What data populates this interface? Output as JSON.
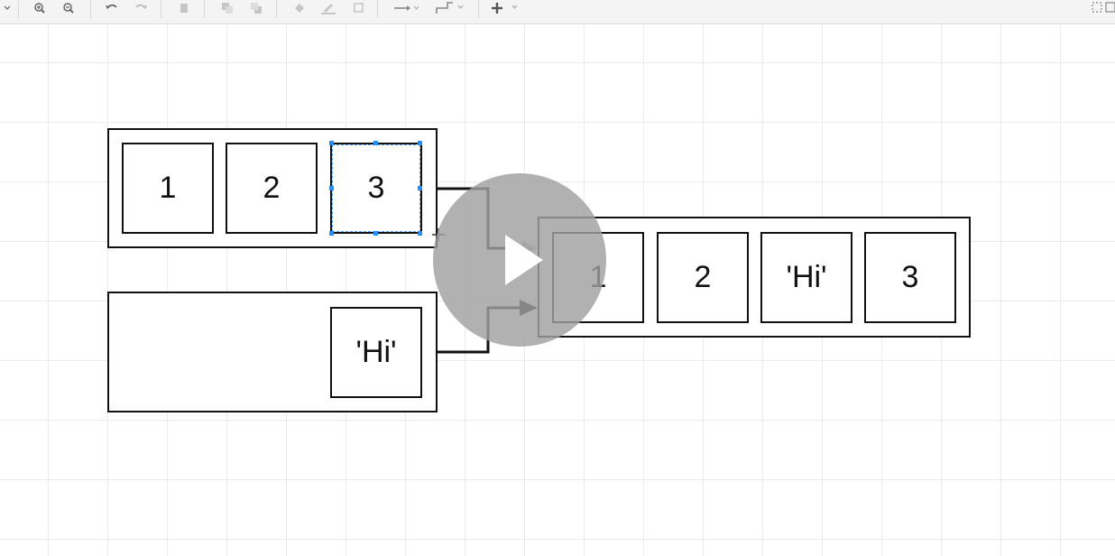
{
  "toolbar": {
    "icons": [
      "zoom-in-icon",
      "zoom-out-icon",
      "undo-icon",
      "redo-icon",
      "delete-icon",
      "to-front-icon",
      "to-back-icon",
      "fill-color-icon",
      "line-color-icon",
      "shadow-icon",
      "connection-icon",
      "waypoints-icon",
      "insert-icon",
      "fullscreen-icon"
    ]
  },
  "diagram": {
    "array_a": [
      "1",
      "2",
      "3"
    ],
    "array_b": [
      "'Hi'"
    ],
    "result": [
      "1",
      "2",
      "'Hi'",
      "3"
    ]
  },
  "video": {
    "state": "paused"
  },
  "colors": {
    "stroke": "#111111",
    "grid": "#ececec",
    "selection": "#4aa3ff",
    "overlay": "#a0a0a0"
  }
}
